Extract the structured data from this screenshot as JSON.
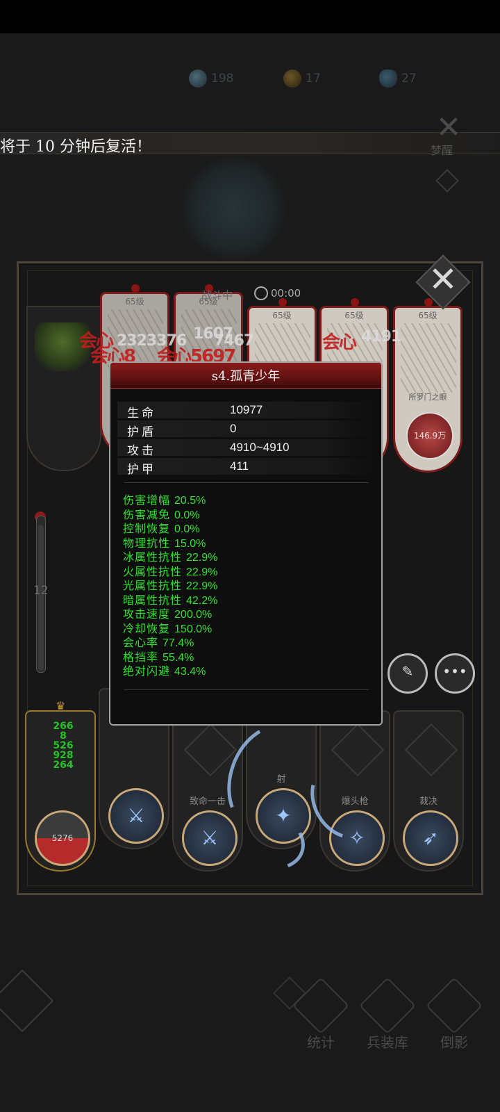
{
  "resources": [
    {
      "icon": "blue-orb-icon",
      "value": "198"
    },
    {
      "icon": "gold-coin-icon",
      "value": "17"
    },
    {
      "icon": "blue-crystal-icon",
      "value": "27"
    }
  ],
  "banner": {
    "message": "将于 10 分钟后复活！"
  },
  "top_right": {
    "wake_label": "梦醒"
  },
  "battle": {
    "timer": "00:00",
    "level_label": "65级",
    "boss_name": "所罗门之眼",
    "boss_hp": "146.9万",
    "slider_value": "12",
    "floating": {
      "d1": "2323376",
      "d2": "1607",
      "d3": "7467",
      "d4": "4191",
      "r1": "会心",
      "r2": "会心8",
      "r3": "会心5697",
      "r4": "会心"
    }
  },
  "skills": [
    {
      "name": "",
      "hp_value": "5276"
    },
    {
      "name": ""
    },
    {
      "name": "致命一击"
    },
    {
      "name": "射"
    },
    {
      "name": "爆头枪"
    },
    {
      "name": "裁决"
    }
  ],
  "bar_numbers": [
    "266",
    "8",
    "526",
    "928",
    "264"
  ],
  "popup": {
    "title": "s4.孤青少年",
    "stats": [
      {
        "k": "生命",
        "v": "10977"
      },
      {
        "k": "护盾",
        "v": "0"
      },
      {
        "k": "攻击",
        "v": "4910~4910"
      },
      {
        "k": "护甲",
        "v": "411"
      }
    ],
    "attributes": [
      {
        "k": "伤害增幅",
        "v": "20.5%"
      },
      {
        "k": "伤害减免",
        "v": "0.0%"
      },
      {
        "k": "控制恢复",
        "v": "0.0%"
      },
      {
        "k": "物理抗性",
        "v": "15.0%"
      },
      {
        "k": "冰属性抗性",
        "v": "22.9%"
      },
      {
        "k": "火属性抗性",
        "v": "22.9%"
      },
      {
        "k": "光属性抗性",
        "v": "22.9%"
      },
      {
        "k": "暗属性抗性",
        "v": "42.2%"
      },
      {
        "k": "攻击速度",
        "v": "200.0%"
      },
      {
        "k": "冷却恢复",
        "v": "150.0%"
      },
      {
        "k": "会心率",
        "v": "77.4%"
      },
      {
        "k": "格挡率",
        "v": "55.4%"
      },
      {
        "k": "绝对闪避",
        "v": "43.4%"
      }
    ]
  },
  "nav": [
    {
      "label": "统计",
      "icon": "stats-icon"
    },
    {
      "label": "兵装库",
      "icon": "armory-icon"
    },
    {
      "label": "倒影",
      "icon": "reflection-icon"
    }
  ],
  "colors": {
    "accent_red": "#8c1b1b",
    "attr_green": "#2ee02e",
    "gold": "#c9982a"
  }
}
